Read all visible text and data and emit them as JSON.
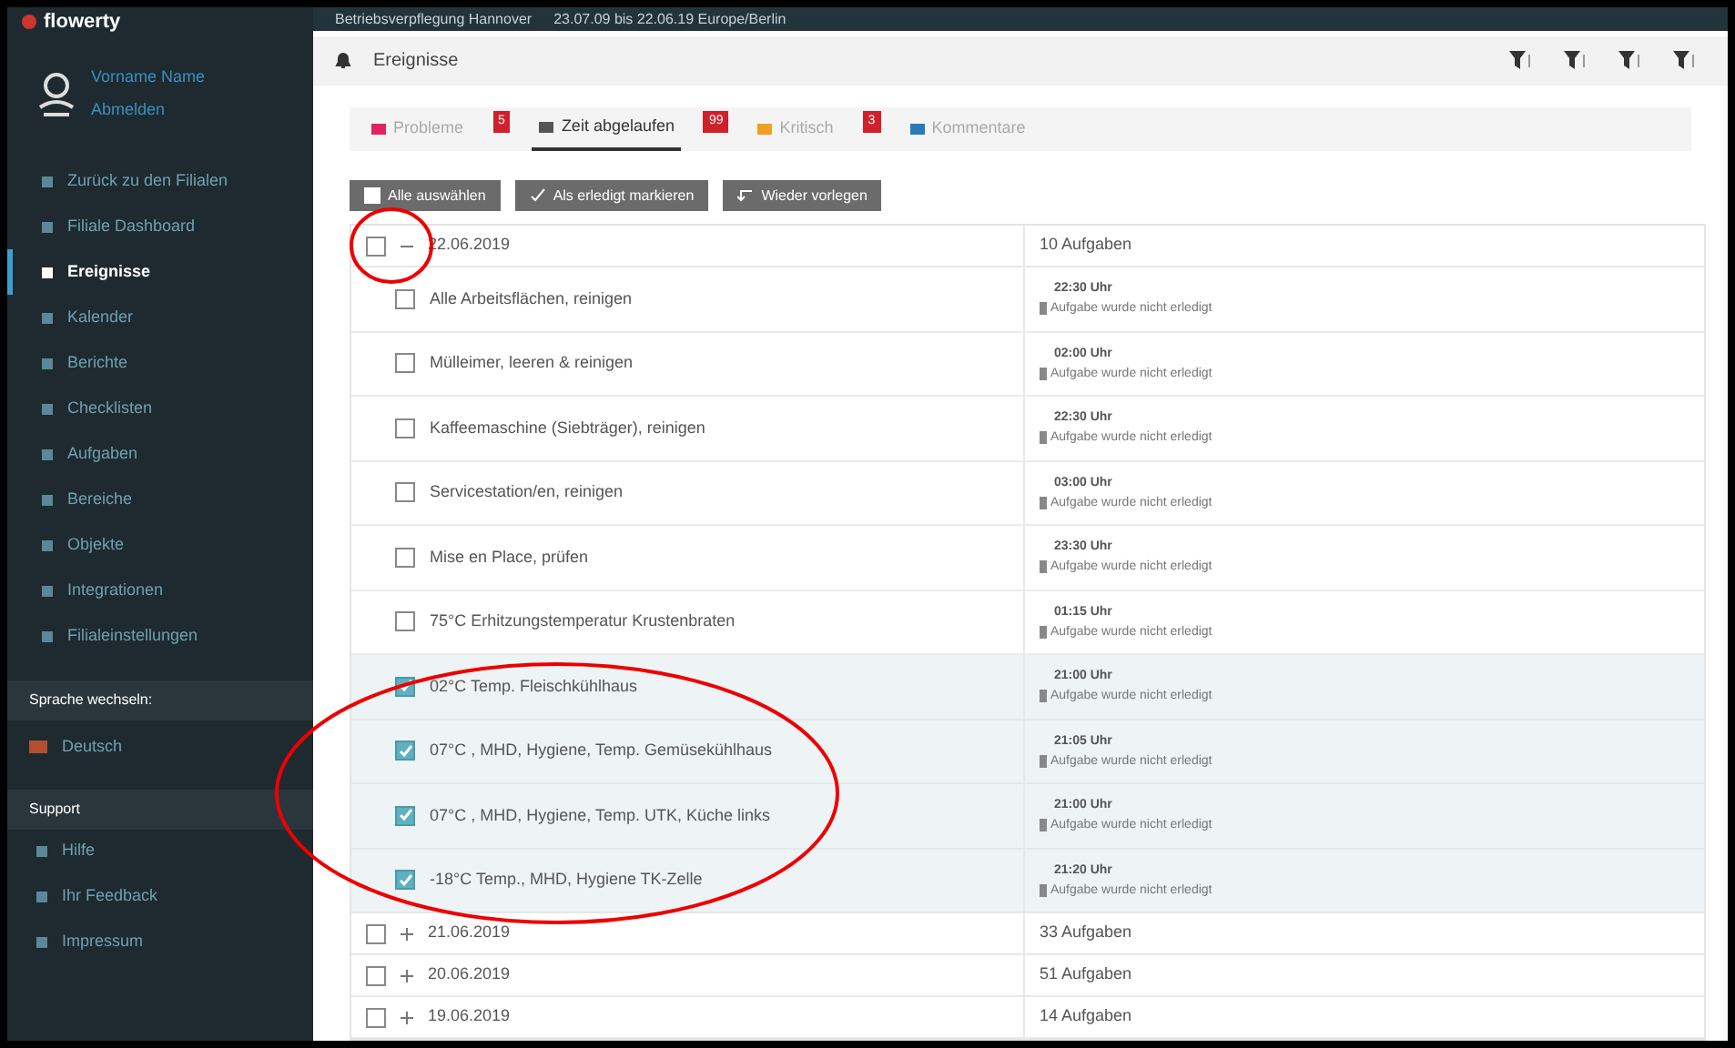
{
  "app": {
    "logo": "flowerty"
  },
  "user": {
    "name": "Vorname Name",
    "action": "Abmelden"
  },
  "sidebar": {
    "items": [
      {
        "label": "Zurück zu den Filialen",
        "selected": false
      },
      {
        "label": "Filiale Dashboard",
        "selected": false
      },
      {
        "label": "Ereignisse",
        "selected": true
      },
      {
        "label": "Kalender",
        "selected": false
      },
      {
        "label": "Berichte",
        "selected": false
      },
      {
        "label": "Checklisten",
        "selected": false
      },
      {
        "label": "Aufgaben",
        "selected": false
      },
      {
        "label": "Bereiche",
        "selected": false
      },
      {
        "label": "Objekte",
        "selected": false
      },
      {
        "label": "Integrationen",
        "selected": false
      },
      {
        "label": "Filialeinstellungen",
        "selected": false
      }
    ],
    "language": {
      "heading": "Sprache wechseln:",
      "value": "Deutsch"
    },
    "support": {
      "heading": "Support",
      "items": [
        "Hilfe",
        "Ihr Feedback",
        "Impressum"
      ]
    }
  },
  "top_bar": {
    "title": "Betriebsverpflegung Hannover",
    "range": "23.07.09 bis 22.06.19 Europe/Berlin"
  },
  "header": {
    "title": "Ereignisse"
  },
  "tabs": [
    {
      "label": "Probleme",
      "badge": "5",
      "selected": false,
      "color": "#e0245e"
    },
    {
      "label": "Zeit abgelaufen",
      "badge": "99",
      "selected": true,
      "color": "#555555"
    },
    {
      "label": "Kritisch",
      "badge": "3",
      "selected": false,
      "color": "#f0a020"
    },
    {
      "label": "Kommentare",
      "selected": false,
      "color": "#2a7ab8"
    }
  ],
  "actions": [
    "Alle auswählen",
    "Als erledigt markieren",
    "Wieder vorlegen"
  ],
  "groups": [
    {
      "date": "22.06.2019",
      "count": "10 Aufgaben",
      "expanded": true,
      "checked": false,
      "tasks": [
        {
          "name": "Alle Arbeitsflächen, reinigen",
          "time": "22:30 Uhr",
          "status": "Aufgabe wurde nicht erledigt",
          "checked": false
        },
        {
          "name": "Mülleimer, leeren & reinigen",
          "time": "02:00 Uhr",
          "status": "Aufgabe wurde nicht erledigt",
          "checked": false
        },
        {
          "name": "Kaffeemaschine (Siebträger), reinigen",
          "time": "22:30 Uhr",
          "status": "Aufgabe wurde nicht erledigt",
          "checked": false
        },
        {
          "name": "Servicestation/en, reinigen",
          "time": "03:00 Uhr",
          "status": "Aufgabe wurde nicht erledigt",
          "checked": false
        },
        {
          "name": "Mise en Place, prüfen",
          "time": "23:30 Uhr",
          "status": "Aufgabe wurde nicht erledigt",
          "checked": false
        },
        {
          "name": "75°C Erhitzungstemperatur Krustenbraten",
          "time": "01:15 Uhr",
          "status": "Aufgabe wurde nicht erledigt",
          "checked": false
        },
        {
          "name": "02°C Temp. Fleischkühlhaus",
          "time": "21:00 Uhr",
          "status": "Aufgabe wurde nicht erledigt",
          "checked": true
        },
        {
          "name": "07°C , MHD, Hygiene, Temp. Gemüsekühlhaus",
          "time": "21:05 Uhr",
          "status": "Aufgabe wurde nicht erledigt",
          "checked": true
        },
        {
          "name": "07°C , MHD, Hygiene, Temp. UTK, Küche links",
          "time": "21:00 Uhr",
          "status": "Aufgabe wurde nicht erledigt",
          "checked": true
        },
        {
          "name": "-18°C Temp., MHD, Hygiene TK-Zelle",
          "time": "21:20 Uhr",
          "status": "Aufgabe wurde nicht erledigt",
          "checked": true
        }
      ]
    },
    {
      "date": "21.06.2019",
      "count": "33 Aufgaben",
      "expanded": false,
      "checked": false
    },
    {
      "date": "20.06.2019",
      "count": "51 Aufgaben",
      "expanded": false,
      "checked": false
    },
    {
      "date": "19.06.2019",
      "count": "14 Aufgaben",
      "expanded": false,
      "checked": false
    }
  ]
}
